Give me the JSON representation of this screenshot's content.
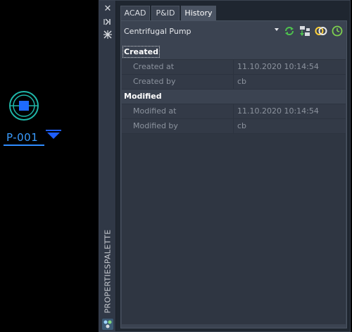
{
  "drawing": {
    "tag": "P-001",
    "colors": {
      "symbol": "#1fb6a8",
      "tag": "#3a9cff",
      "arrow": "#1e5eff"
    }
  },
  "palette": {
    "title": "PROPERTIESPALETTE",
    "icons": [
      "close-icon",
      "auto-hide-icon",
      "properties-icon",
      "palette-settings-icon"
    ]
  },
  "tabs": [
    {
      "label": "ACAD"
    },
    {
      "label": "P&ID"
    },
    {
      "label": "History",
      "active": true
    }
  ],
  "selector": {
    "value": "Centrifugal Pump"
  },
  "toolbar": {
    "icons": [
      "refresh-icon",
      "select-object-icon",
      "filter-icon",
      "history-icon"
    ]
  },
  "groups": [
    {
      "label": "Created",
      "rows": [
        {
          "key": "Created at",
          "value": "11.10.2020 10:14:54"
        },
        {
          "key": "Created by",
          "value": "cb"
        }
      ]
    },
    {
      "label": "Modified",
      "rows": [
        {
          "key": "Modified at",
          "value": "11.10.2020 10:14:54"
        },
        {
          "key": "Modified by",
          "value": "cb"
        }
      ]
    }
  ]
}
